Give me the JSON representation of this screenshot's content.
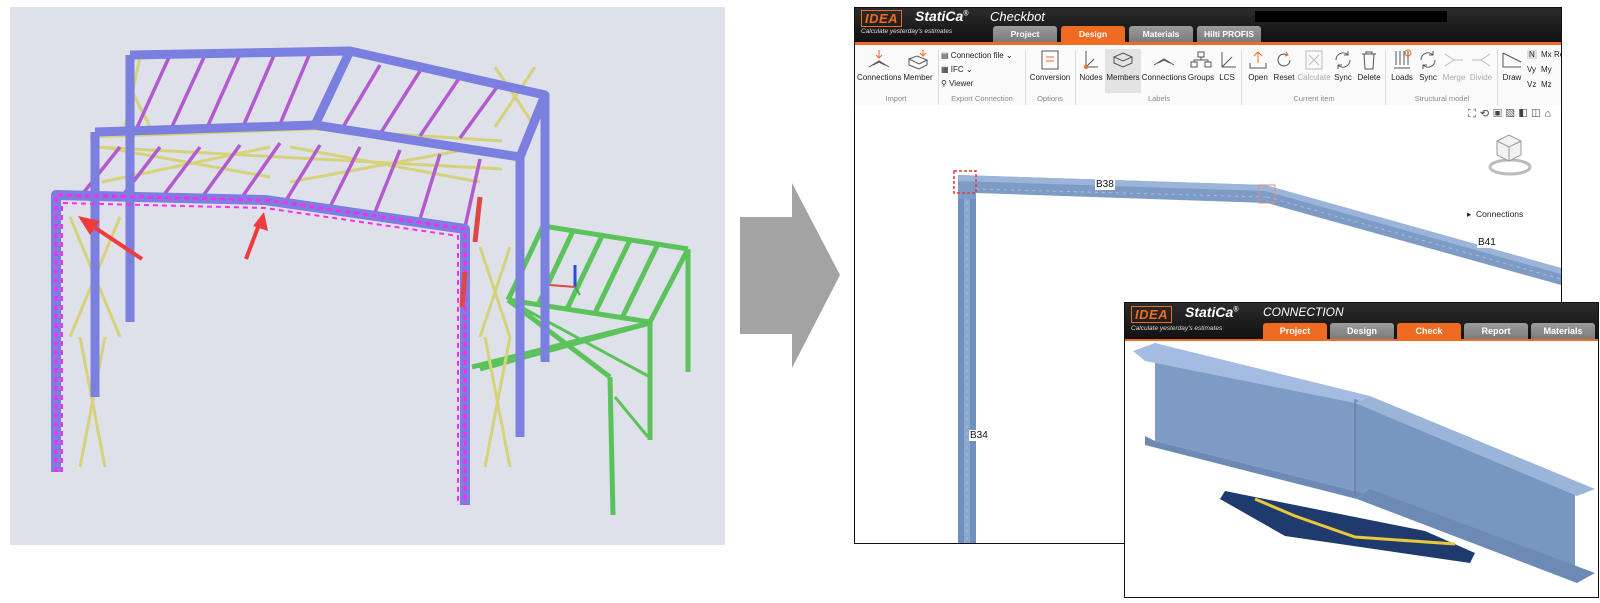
{
  "checkbot": {
    "brand_logo": "IDEA",
    "brand_name": "StatiCa",
    "brand_mark": "®",
    "app_name": "Checkbot",
    "tagline": "Calculate yesterday's estimates",
    "tabs": [
      {
        "label": "Project",
        "active": false
      },
      {
        "label": "Design",
        "active": true
      },
      {
        "label": "Materials",
        "active": false
      },
      {
        "label": "Hilti PROFIS",
        "active": false
      }
    ],
    "ribbon": {
      "import": {
        "label": "Import",
        "connections": "Connections",
        "member": "Member"
      },
      "export": {
        "label": "Export Connection",
        "connection_file": "Connection file",
        "ifc": "IFC",
        "viewer": "Viewer"
      },
      "options": {
        "label": "Options",
        "conversion": "Conversion"
      },
      "labels": {
        "label": "Labels",
        "nodes": "Nodes",
        "members": "Members",
        "connections": "Connections",
        "groups": "Groups",
        "lcs": "LCS"
      },
      "current_item": {
        "label": "Current item",
        "open": "Open",
        "reset": "Reset",
        "calculate": "Calculate",
        "sync": "Sync",
        "delete": "Delete"
      },
      "structural_model": {
        "label": "Structural model",
        "loads": "Loads",
        "sync": "Sync",
        "merge": "Merge",
        "divide": "Divide"
      },
      "results": {
        "draw": "Draw",
        "n": "N",
        "mx": "Mx",
        "vy": "Vy",
        "my": "My",
        "vz": "Vz",
        "mz": "Mz",
        "result": "Result"
      }
    },
    "viewport": {
      "members": [
        "B38",
        "B41",
        "B34"
      ],
      "connections_panel": "Connections"
    }
  },
  "connection": {
    "brand_logo": "IDEA",
    "brand_name": "StatiCa",
    "brand_mark": "®",
    "app_name": "CONNECTION",
    "tagline": "Calculate yesterday's estimates",
    "tabs": [
      {
        "label": "Project",
        "active": true
      },
      {
        "label": "Design",
        "active": false
      },
      {
        "label": "Check",
        "active": true
      },
      {
        "label": "Report",
        "active": false
      },
      {
        "label": "Materials",
        "active": false
      }
    ]
  },
  "colors": {
    "accent": "#f06b22",
    "member_blue": "#7d9bc4",
    "frame_purple": "#7b7fe0",
    "selection_magenta": "#ff2cf0",
    "bracing_yellow": "#d6d27a",
    "canopy_green": "#5cc35c",
    "arrow_gray": "#a3a3a3"
  }
}
